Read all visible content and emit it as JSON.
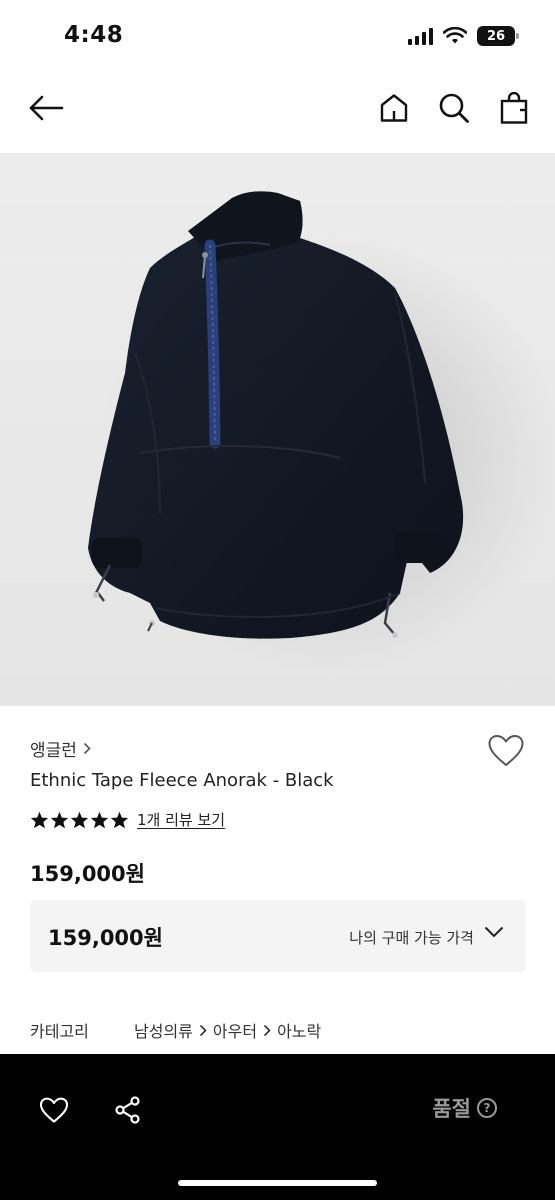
{
  "status_bar": {
    "time": "4:48",
    "battery": "26"
  },
  "nav": {
    "back_icon": "arrow-left-icon",
    "home_icon": "home-icon",
    "search_icon": "search-icon",
    "bag_icon": "shopping-bag-icon"
  },
  "product": {
    "image_icon": "fleece-anorak-photo",
    "brand": "앵글런",
    "name": "Ethnic Tape Fleece Anorak - Black",
    "rating_stars": 5,
    "review_link": "1개 리뷰 보기",
    "price": "159,000원"
  },
  "buy_price": {
    "value": "159,000원",
    "label": "나의 구매 가능 가격"
  },
  "category": {
    "label": "카테고리",
    "path": [
      "남성의류",
      "아우터",
      "아노락"
    ]
  },
  "bottom_bar": {
    "status": "품절",
    "help": "?"
  }
}
